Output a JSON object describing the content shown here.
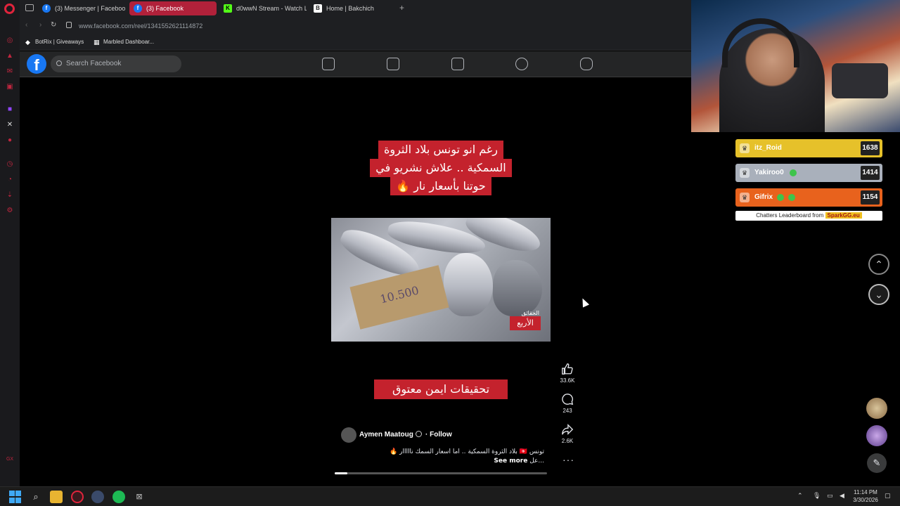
{
  "browser": {
    "tabs": [
      {
        "label": "(3) Messenger | Facebook",
        "favicon": "facebook-icon",
        "active": false
      },
      {
        "label": "(3) Facebook",
        "favicon": "facebook-icon",
        "active": true
      },
      {
        "label": "d0wwN Stream - Watch L",
        "favicon": "kick-icon",
        "active": false
      },
      {
        "label": "Home | Bakchich",
        "favicon": "bakchich-icon",
        "active": false
      }
    ],
    "new_tab": "+",
    "url": "www.facebook.com/reel/1341552621114872",
    "bookmarks": [
      {
        "label": "BotRix | Giveaways",
        "icon": "botrix-icon"
      },
      {
        "label": "Marbled Dashboar...",
        "icon": "grid-icon"
      }
    ]
  },
  "facebook": {
    "logo": "f",
    "search_placeholder": "Search Facebook",
    "nav_icons": [
      "home-icon",
      "video-icon",
      "marketplace-icon",
      "groups-icon",
      "gaming-icon"
    ]
  },
  "reel": {
    "caption_top_lines": [
      "رغم انو تونس بلاد الثروة",
      "السمكية .. علاش نشريو في",
      "حوتنا بأسعار نار 🔥"
    ],
    "image_price_text": "10.500",
    "watermark": "الأربع",
    "watermark_small": "الحقائق",
    "caption_bottom": "تحقيقات ايمن معتوق",
    "author": "Aymen Maatoug",
    "follow": "· Follow",
    "description_line1": "تونس 🇹🇳 بلاد الثروة السمكية .. اما اسعار السمك نااااار 🔥",
    "description_line2_prefix": "عل...",
    "see_more": "See more",
    "progress": 0.06,
    "actions": [
      {
        "name": "like",
        "icon": "like-icon",
        "count": "33.6K"
      },
      {
        "name": "comment",
        "icon": "comment-icon",
        "count": "243"
      },
      {
        "name": "share",
        "icon": "share-icon",
        "count": "2.6K"
      }
    ],
    "more": "···"
  },
  "leaderboard": {
    "rows": [
      {
        "name": "itz_Roid",
        "score": "1638",
        "color": "#e6c12a"
      },
      {
        "name": "Yakiroo0",
        "score": "1414",
        "color": "#a9b0bb"
      },
      {
        "name": "Gifrix",
        "score": "1154",
        "color": "#e8621d"
      }
    ],
    "footer_prefix": "Chatters Leaderboard from ",
    "footer_brand": "SparkGG.eu"
  },
  "taskbar": {
    "time": "11:14 PM",
    "date": "3/30/2026"
  }
}
